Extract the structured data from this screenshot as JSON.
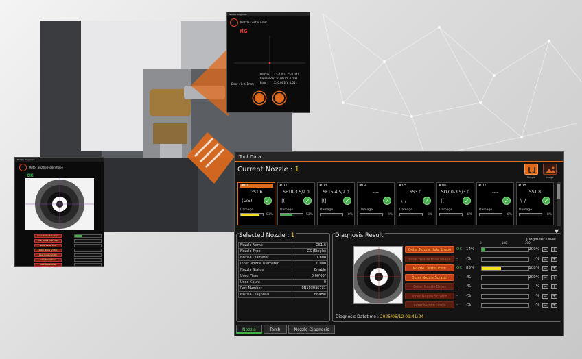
{
  "nozzle_error_popup": {
    "title": "Nozzle Diagnosis",
    "heading": "Nozzle Center Error",
    "status": "NG",
    "readout_labels": [
      "Nozzle",
      "Reference",
      "Error"
    ],
    "readout_values": [
      "X: -0.003 Y: -0.041",
      "X: 0.000 Y: 0.000",
      "X: 0.003 Y: 0.041"
    ],
    "error_caption": "Error : 0.041mm"
  },
  "outer_popup": {
    "title": "Nozzle Diagnosis",
    "heading": "Outer Nozzle Hole Shape",
    "status": "OK",
    "rows": [
      "Outer Nozzle Hole Shape",
      "Inner Nozzle Hole Shape",
      "Nozzle Center Error",
      "Outer Nozzle Scratch",
      "Inner Nozzle Scratch",
      "Outer Nozzle Dross",
      "Inner Nozzle Dross"
    ]
  },
  "window": {
    "title": "Tool Data",
    "current_label": "Current Nozzle : ",
    "current_value": "1",
    "simple_label": "Simple",
    "image_label": "Image"
  },
  "nozzles": [
    {
      "num": "#01",
      "name": "GS1.6",
      "shape": "(GS)",
      "damage_label": "Damage",
      "damage": 83,
      "pct": "83%",
      "color": "#f5e020",
      "selected": true
    },
    {
      "num": "#02",
      "name": "SE10-3.5/2.0",
      "shape": "|(|",
      "damage_label": "Damage",
      "damage": 52,
      "pct": "52%",
      "color": "#43b04a",
      "selected": false
    },
    {
      "num": "#03",
      "name": "SE15-4.5/2.0",
      "shape": "|(|",
      "damage_label": "Damage",
      "damage": 0,
      "pct": "0%",
      "color": "#43b04a",
      "selected": false
    },
    {
      "num": "#04",
      "name": "----",
      "shape": "",
      "damage_label": "Damage",
      "damage": 0,
      "pct": "0%",
      "color": "#43b04a",
      "selected": false
    },
    {
      "num": "#05",
      "name": "SS3.0",
      "shape": "\\_/",
      "damage_label": "Damage",
      "damage": 0,
      "pct": "0%",
      "color": "#43b04a",
      "selected": false
    },
    {
      "num": "#06",
      "name": "SD7.0-3.5/3.0",
      "shape": "|(|",
      "damage_label": "Damage",
      "damage": 0,
      "pct": "0%",
      "color": "#43b04a",
      "selected": false
    },
    {
      "num": "#07",
      "name": "----",
      "shape": "",
      "damage_label": "Damage",
      "damage": 0,
      "pct": "0%",
      "color": "#43b04a",
      "selected": false
    },
    {
      "num": "#08",
      "name": "SS1.8",
      "shape": "\\_/",
      "damage_label": "Damage",
      "damage": 0,
      "pct": "0%",
      "color": "#43b04a",
      "selected": false
    }
  ],
  "selected_nozzle": {
    "label": "Selected Nozzle : ",
    "value": "1",
    "rows": [
      {
        "k": "Nozzle Name",
        "v": "GS1.6"
      },
      {
        "k": "Nozzle Type",
        "v": "GS (Single)"
      },
      {
        "k": "Nozzle Diameter",
        "v": "1.600"
      },
      {
        "k": "Inner Nozzle Diameter",
        "v": "0.000"
      },
      {
        "k": "Nozzle Status",
        "v": "Enable"
      },
      {
        "k": "Used Time",
        "v": "0:00'00\""
      },
      {
        "k": "Used Count",
        "v": "0"
      },
      {
        "k": "Part Number",
        "v": "0N103035731"
      },
      {
        "k": "Nozzle Diagnosis",
        "v": "Enable"
      }
    ]
  },
  "diagnosis": {
    "label": "Diagnosis Result",
    "axis": [
      "0",
      "100",
      "200"
    ],
    "judgment_label": "Judgment Level",
    "datetime_label": "Diagnosis Datetime : ",
    "datetime_value": "2025/06/12 09:41:24",
    "items": [
      {
        "name": "Outer Nozzle Hole Shape",
        "active": true,
        "result": "OK",
        "pct": "14%",
        "level": 14,
        "color": "#43b04a",
        "judge": "200%"
      },
      {
        "name": "Inner Nozzle Hole Shape",
        "active": false,
        "result": "-",
        "pct": "-%",
        "level": 0,
        "color": "#43b04a",
        "judge": "-%"
      },
      {
        "name": "Nozzle Center Error",
        "active": true,
        "result": "OK",
        "pct": "83%",
        "level": 83,
        "color": "#f5e020",
        "judge": "100%"
      },
      {
        "name": "Outer Nozzle Scratch",
        "active": true,
        "result": "-",
        "pct": "-%",
        "level": 0,
        "color": "#43b04a",
        "judge": "200%"
      },
      {
        "name": "Outer Nozzle Dross",
        "active": false,
        "result": "-",
        "pct": "-%",
        "level": 0,
        "color": "#43b04a",
        "judge": "-%"
      },
      {
        "name": "Inner Nozzle Scratch",
        "active": false,
        "result": "-",
        "pct": "-%",
        "level": 0,
        "color": "#43b04a",
        "judge": "-%"
      },
      {
        "name": "Inner Nozzle Dross",
        "active": false,
        "result": "-",
        "pct": "-%",
        "level": 0,
        "color": "#43b04a",
        "judge": "-%"
      }
    ]
  },
  "tabs": [
    "Nozzle",
    "Torch",
    "Nozzle Diagnosis"
  ]
}
